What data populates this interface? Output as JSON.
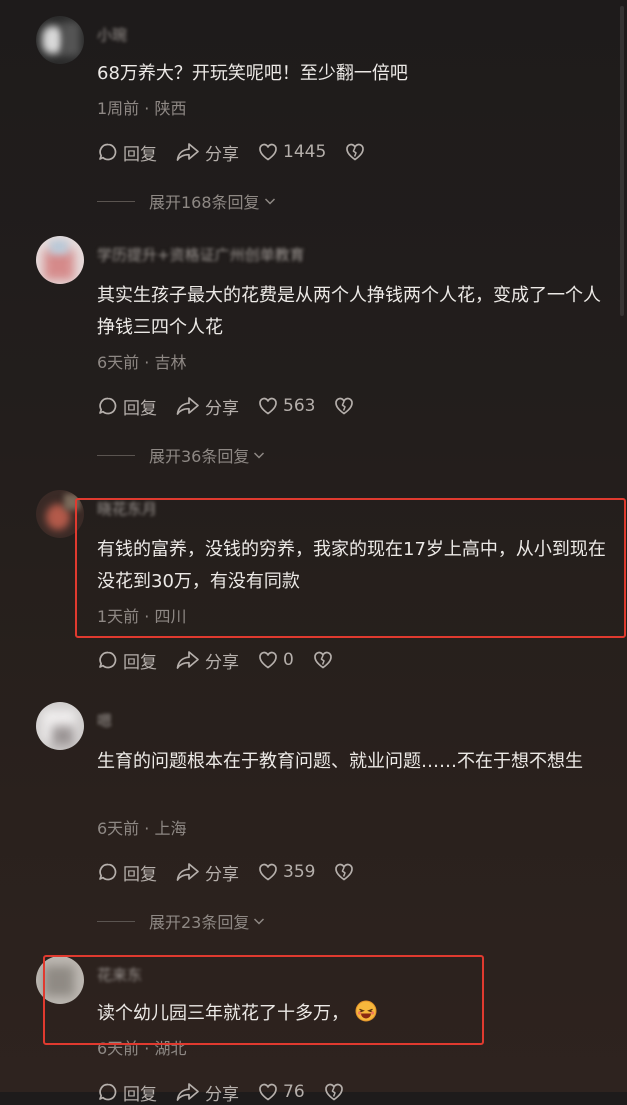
{
  "labels": {
    "reply": "回复",
    "share": "分享"
  },
  "comments": [
    {
      "username": "小琬",
      "text": "68万养大？开玩笑呢吧！至少翻一倍吧",
      "meta": "1周前 · 陕西",
      "likes": "1445",
      "expand": "展开168条回复"
    },
    {
      "username": "学历提升+资格证广州创单教育",
      "text": "其实生孩子最大的花费是从两个人挣钱两个人花，变成了一个人挣钱三四个人花",
      "meta": "6天前 · 吉林",
      "likes": "563",
      "expand": "展开36条回复"
    },
    {
      "username": "晓花东月",
      "text": "有钱的富养，没钱的穷养，我家的现在17岁上高中，从小到现在没花到30万，有没有同款",
      "meta": "1天前 · 四川",
      "likes": "0"
    },
    {
      "username": "嗯",
      "text": "生育的问题根本在于教育问题、就业问题……不在于想不想生",
      "meta": "6天前 · 上海",
      "likes": "359",
      "expand": "展开23条回复"
    },
    {
      "username": "花来东",
      "text": "读个幼儿园三年就花了十多万，",
      "meta": "6天前 · 湖北",
      "likes": "76"
    }
  ]
}
